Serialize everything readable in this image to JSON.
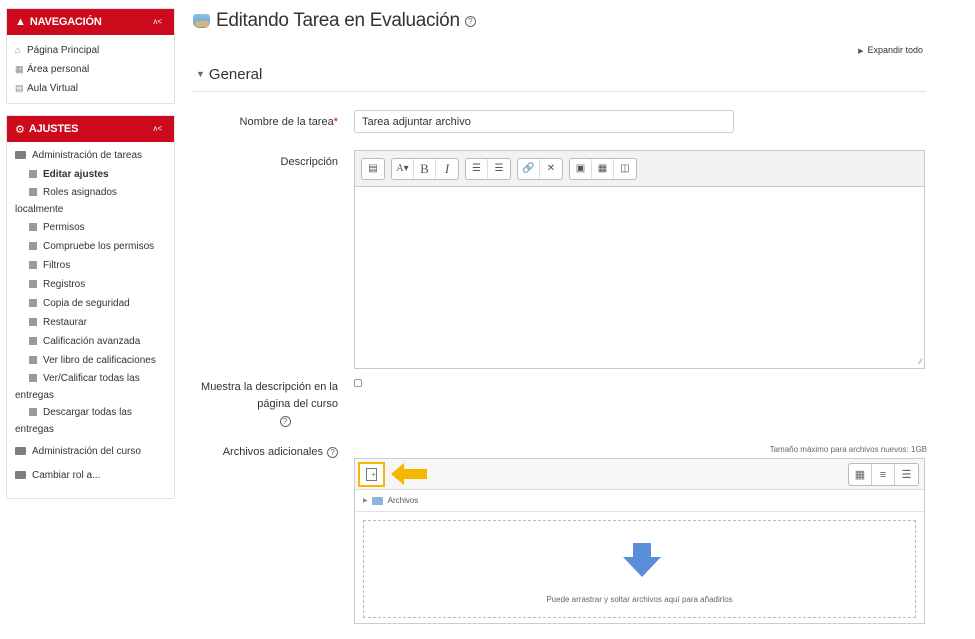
{
  "navigation": {
    "title": "NAVEGACIÓN",
    "collapse": "ᴧ<",
    "items": [
      {
        "label": "Página Principal",
        "icon": "home-icon"
      },
      {
        "label": "Área personal",
        "icon": "dashboard-icon"
      },
      {
        "label": "Aula Virtual",
        "icon": "folder-icon"
      }
    ]
  },
  "settings": {
    "title": "AJUSTES",
    "collapse": "ᴧ<",
    "admin_tasks": "Administración de tareas",
    "items": [
      "Editar ajustes",
      "Roles asignados localmente",
      "Permisos",
      "Compruebe los permisos",
      "Filtros",
      "Registros",
      "Copia de seguridad",
      "Restaurar",
      "Calificación avanzada",
      "Ver libro de calificaciones",
      "Ver/Calificar todas las entregas",
      "Descargar todas las entregas"
    ],
    "course_admin": "Administración del curso",
    "switch_role": "Cambiar rol a..."
  },
  "page": {
    "title": "Editando Tarea en Evaluación",
    "expand_all": "Expandir todo",
    "section": "General"
  },
  "form": {
    "name_label": "Nombre de la tarea",
    "name_required": "*",
    "name_value": "Tarea adjuntar archivo",
    "description_label": "Descripción",
    "show_desc_label": "Muestra la descripción en la página del curso",
    "files_label": "Archivos adicionales",
    "max_size": "Tamaño máximo para archivos nuevos: 1GB",
    "folder_label": "Archivos",
    "drop_hint": "Puede arrastrar y soltar archivos aquí para añadirlos"
  },
  "colors": {
    "brand_red": "#cc0a1c",
    "highlight_yellow": "#f5b800",
    "drop_blue": "#5b8ed8"
  }
}
